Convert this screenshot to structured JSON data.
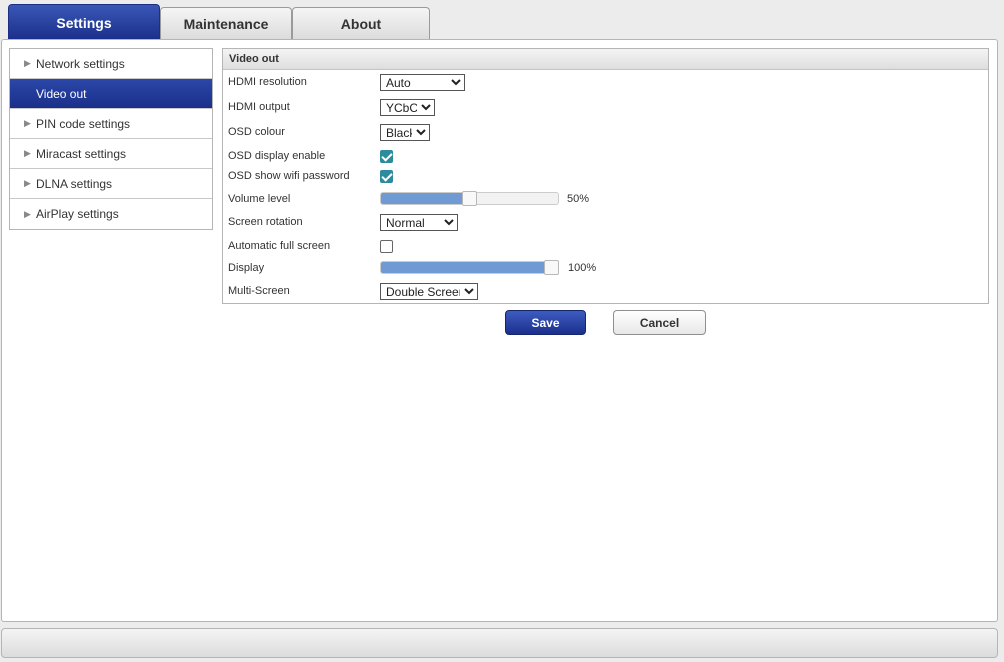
{
  "tabs": [
    {
      "label": "Settings",
      "active": true
    },
    {
      "label": "Maintenance",
      "active": false
    },
    {
      "label": "About",
      "active": false
    }
  ],
  "sidebar": {
    "items": [
      {
        "label": "Network settings",
        "active": false
      },
      {
        "label": "Video out",
        "active": true
      },
      {
        "label": "PIN code settings",
        "active": false
      },
      {
        "label": "Miracast settings",
        "active": false
      },
      {
        "label": "DLNA settings",
        "active": false
      },
      {
        "label": "AirPlay settings",
        "active": false
      }
    ],
    "arrow_glyph": "▶"
  },
  "video_out": {
    "title": "Video out",
    "hdmi_resolution": {
      "label": "HDMI resolution",
      "value": "Auto"
    },
    "hdmi_output": {
      "label": "HDMI output",
      "value": "YCbCr"
    },
    "osd_colour": {
      "label": "OSD colour",
      "value": "Black"
    },
    "osd_display_enable": {
      "label": "OSD display enable",
      "checked": true
    },
    "osd_show_wifi_password": {
      "label": "OSD show wifi password",
      "checked": true
    },
    "volume_level": {
      "label": "Volume level",
      "value": 50,
      "text": "50%"
    },
    "screen_rotation": {
      "label": "Screen rotation",
      "value": "Normal"
    },
    "automatic_full_screen": {
      "label": "Automatic full screen",
      "checked": false
    },
    "display": {
      "label": "Display",
      "value": 100,
      "text": "100%"
    },
    "multi_screen": {
      "label": "Multi-Screen",
      "value": "Double Screen"
    }
  },
  "actions": {
    "save_label": "Save",
    "cancel_label": "Cancel"
  },
  "colors": {
    "accent": "#1a2f8a",
    "checkbox": "#2a8c9c",
    "slider_fill": "#6f9ad4"
  }
}
